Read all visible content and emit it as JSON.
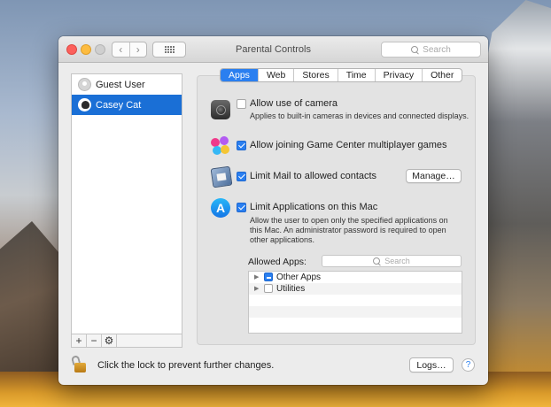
{
  "window": {
    "title": "Parental Controls",
    "search_placeholder": "Search"
  },
  "sidebar": {
    "users": [
      {
        "name": "Guest User",
        "selected": false
      },
      {
        "name": "Casey Cat",
        "selected": true
      }
    ],
    "tools": [
      "+",
      "−",
      "⚙"
    ]
  },
  "tabs": [
    {
      "label": "Apps",
      "active": true
    },
    {
      "label": "Web",
      "active": false
    },
    {
      "label": "Stores",
      "active": false
    },
    {
      "label": "Time",
      "active": false
    },
    {
      "label": "Privacy",
      "active": false
    },
    {
      "label": "Other",
      "active": false
    }
  ],
  "settings": {
    "camera": {
      "label": "Allow use of camera",
      "checked": false,
      "description": "Applies to built-in cameras in devices and connected displays.",
      "icon": "camera-icon"
    },
    "game_center": {
      "label": "Allow joining Game Center multiplayer games",
      "checked": true,
      "icon": "game-center-icon"
    },
    "mail": {
      "label": "Limit Mail to allowed contacts",
      "checked": true,
      "button": "Manage…",
      "icon": "mail-icon"
    },
    "applications": {
      "label": "Limit Applications on this Mac",
      "checked": true,
      "description": "Allow the user to open only the specified applications on this Mac. An administrator password is required to open other applications.",
      "icon": "app-store-icon",
      "allowed_apps_label": "Allowed Apps:",
      "search_placeholder": "Search",
      "apps": [
        {
          "name": "Other Apps",
          "state": "mixed"
        },
        {
          "name": "Utilities",
          "state": "unchecked"
        }
      ]
    }
  },
  "footer": {
    "lock_text": "Click the lock to prevent further changes.",
    "logs_button": "Logs…",
    "help": "?"
  },
  "colors": {
    "accent": "#2a7ff0",
    "selection": "#1a6fd6"
  }
}
